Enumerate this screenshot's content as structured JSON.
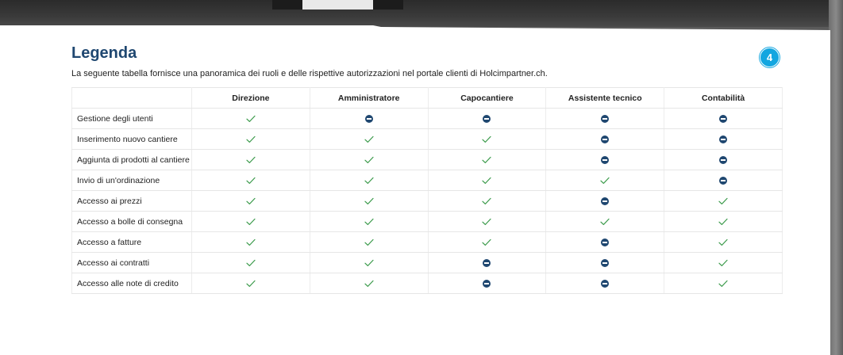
{
  "legend": {
    "title": "Legenda",
    "description": "La seguente tabella fornisce una panoramica dei ruoli e delle rispettive autorizzazioni nel portale clienti di Holcimpartner.ch.",
    "columns": [
      "Direzione",
      "Amministratore",
      "Capocantiere",
      "Assistente tecnico",
      "Contabilità"
    ],
    "rows": [
      {
        "label": "Gestione degli utenti",
        "cells": [
          "yes",
          "no",
          "no",
          "no",
          "no"
        ]
      },
      {
        "label": "Inserimento nuovo cantiere",
        "cells": [
          "yes",
          "yes",
          "yes",
          "no",
          "no"
        ]
      },
      {
        "label": "Aggiunta di prodotti al cantiere",
        "cells": [
          "yes",
          "yes",
          "yes",
          "no",
          "no"
        ]
      },
      {
        "label": "Invio di un'ordinazione",
        "cells": [
          "yes",
          "yes",
          "yes",
          "yes",
          "no"
        ]
      },
      {
        "label": "Accesso ai prezzi",
        "cells": [
          "yes",
          "yes",
          "yes",
          "no",
          "yes"
        ]
      },
      {
        "label": "Accesso a bolle di consegna",
        "cells": [
          "yes",
          "yes",
          "yes",
          "yes",
          "yes"
        ]
      },
      {
        "label": "Accesso a fatture",
        "cells": [
          "yes",
          "yes",
          "yes",
          "no",
          "yes"
        ]
      },
      {
        "label": "Accesso ai contratti",
        "cells": [
          "yes",
          "yes",
          "no",
          "no",
          "yes"
        ]
      },
      {
        "label": "Accesso alle note di credito",
        "cells": [
          "yes",
          "yes",
          "no",
          "no",
          "yes"
        ]
      }
    ]
  },
  "badge": {
    "number": "4"
  },
  "icons": {
    "allowed": "check-icon",
    "denied": "minus-circle-icon"
  },
  "colors": {
    "title": "#1f4770",
    "check": "#3a9a4a",
    "deny": "#1f4770",
    "badge": "#13a6e0"
  }
}
